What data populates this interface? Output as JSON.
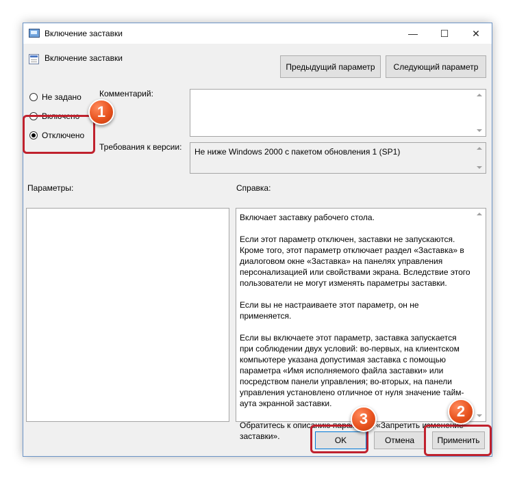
{
  "window": {
    "title": "Включение заставки",
    "minimize_glyph": "—",
    "maximize_glyph": "☐",
    "close_glyph": "✕"
  },
  "policy": {
    "name": "Включение заставки",
    "prev_button": "Предыдущий параметр",
    "next_button": "Следующий параметр"
  },
  "state": {
    "options": [
      {
        "label": "Не задано",
        "checked": false
      },
      {
        "label": "Включено",
        "checked": false
      },
      {
        "label": "Отключено",
        "checked": true
      }
    ]
  },
  "comment": {
    "label": "Комментарий:",
    "value": ""
  },
  "requirements": {
    "label": "Требования к версии:",
    "value": "Не ниже Windows 2000 с пакетом обновления 1 (SP1)"
  },
  "sections": {
    "parameters_label": "Параметры:",
    "help_label": "Справка:"
  },
  "help": {
    "paragraphs": [
      "Включает заставку рабочего стола.",
      "Если этот параметр отключен, заставки не запускаются. Кроме того, этот параметр отключает раздел «Заставка» в диалоговом окне «Заставка» на панелях управления персонализацией или свойствами экрана. Вследствие этого пользователи не могут изменять параметры заставки.",
      "Если вы не настраиваете этот параметр, он не применяется.",
      "Если вы включаете этот параметр, заставка запускается при соблюдении двух условий: во-первых, на клиентском компьютере указана допустимая заставка с помощью параметра «Имя исполняемого файла заставки» или посредством панели управления; во-вторых, на панели управления установлено отличное от нуля значение тайм-аута экранной заставки.",
      "Обратитесь к описанию параметра «Запретить изменение заставки»."
    ]
  },
  "buttons": {
    "ok": "OK",
    "cancel": "Отмена",
    "apply": "Применить"
  },
  "annotations": {
    "badges": [
      "1",
      "2",
      "3"
    ],
    "highlight_color": "#c0212d",
    "badge_color": "#e8531f"
  }
}
